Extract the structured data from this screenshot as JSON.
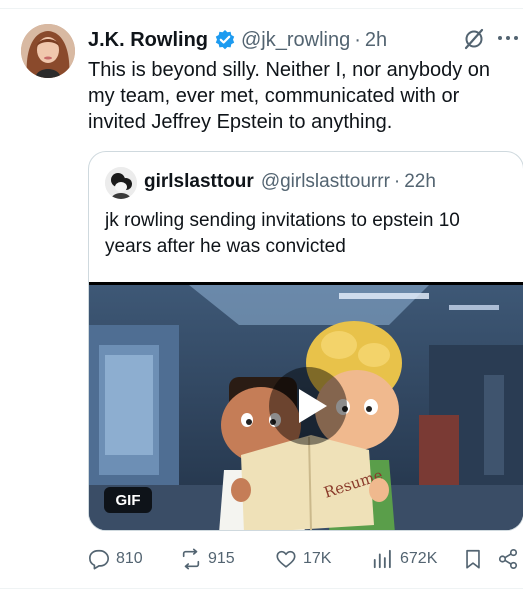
{
  "tweet": {
    "author_name": "J.K. Rowling",
    "handle": "@jk_rowling",
    "separator": "·",
    "time": "2h",
    "text_lines": [
      "This is beyond silly. Neither I, nor anybody on",
      "my team, ever met, communicated with or",
      "invited Jeffrey Epstein to anything."
    ]
  },
  "quoted_tweet": {
    "author_name": "girlslasttour",
    "handle": "@girlslasttourrr",
    "separator": "·",
    "time": "22h",
    "text_lines": [
      "jk rowling sending invitations to epstein 10",
      "years after he was convicted"
    ],
    "media": {
      "badge": "GIF",
      "sign_text": "Resume"
    }
  },
  "actions": {
    "replies": "810",
    "reposts": "915",
    "likes": "17K",
    "views": "672K"
  },
  "icons": {
    "verified": "verified-badge-icon",
    "grok": "grok-icon",
    "more": "more-icon",
    "reply": "reply-icon",
    "repost": "repost-icon",
    "like": "like-icon",
    "views": "views-icon",
    "bookmark": "bookmark-icon",
    "share": "share-icon"
  },
  "colors": {
    "verified_blue": "#1d9bf0",
    "text_primary": "#0f1419",
    "text_secondary": "#536471",
    "border": "#cfd9de"
  }
}
